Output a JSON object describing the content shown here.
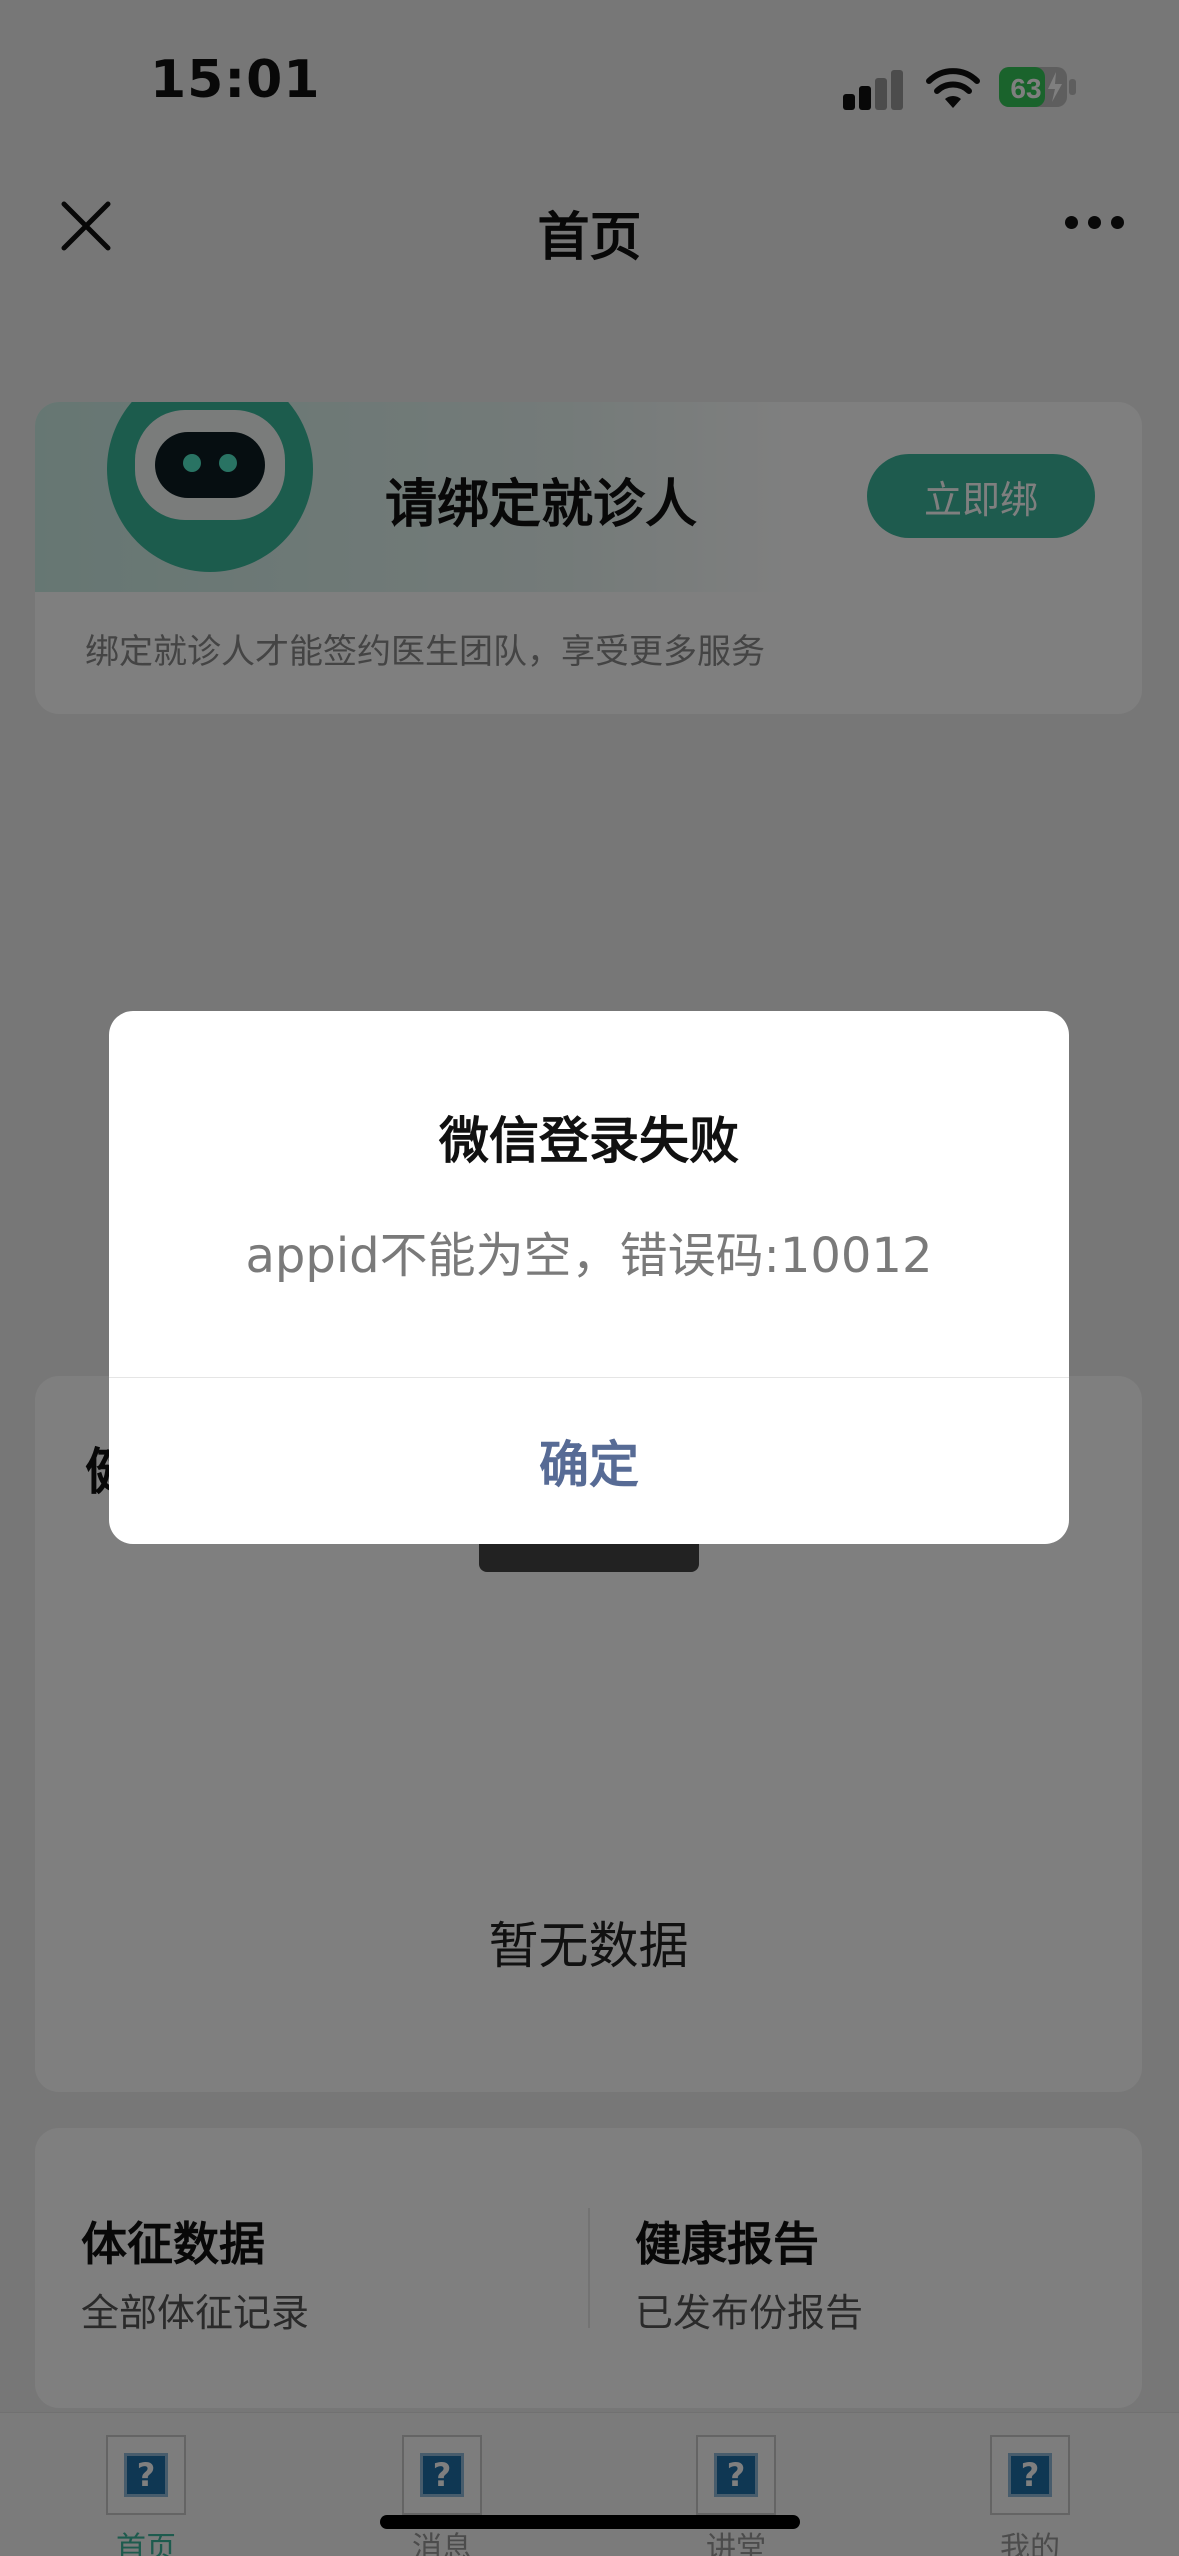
{
  "status_bar": {
    "time": "15:01",
    "battery": "63",
    "icons": [
      "signal-icon",
      "wifi-icon",
      "battery-charging-icon"
    ]
  },
  "nav": {
    "title": "首页",
    "icons": [
      "close-icon",
      "more-icon"
    ]
  },
  "bind_card": {
    "title": "请绑定就诊人",
    "button": "立即绑",
    "description": "绑定就诊人才能签约医生团队，享受更多服务"
  },
  "health_card": {
    "title": "健",
    "empty": "暂无数据"
  },
  "stats": [
    {
      "title": "体征数据",
      "subtitle": "全部体征记录"
    },
    {
      "title": "健康报告",
      "subtitle": "已发布份报告"
    }
  ],
  "tabbar": {
    "tabs": [
      {
        "label": "首页",
        "icon": "?"
      },
      {
        "label": "消息",
        "icon": "?"
      },
      {
        "label": "讲堂",
        "icon": "?"
      },
      {
        "label": "我的",
        "icon": "?"
      }
    ],
    "active_color": "#3cb79c"
  },
  "dialog": {
    "title": "微信登录失败",
    "message": "appid不能为空，错误码:10012",
    "confirm": "确定"
  },
  "colors": {
    "accent": "#3cb79c",
    "link": "#576b95"
  }
}
